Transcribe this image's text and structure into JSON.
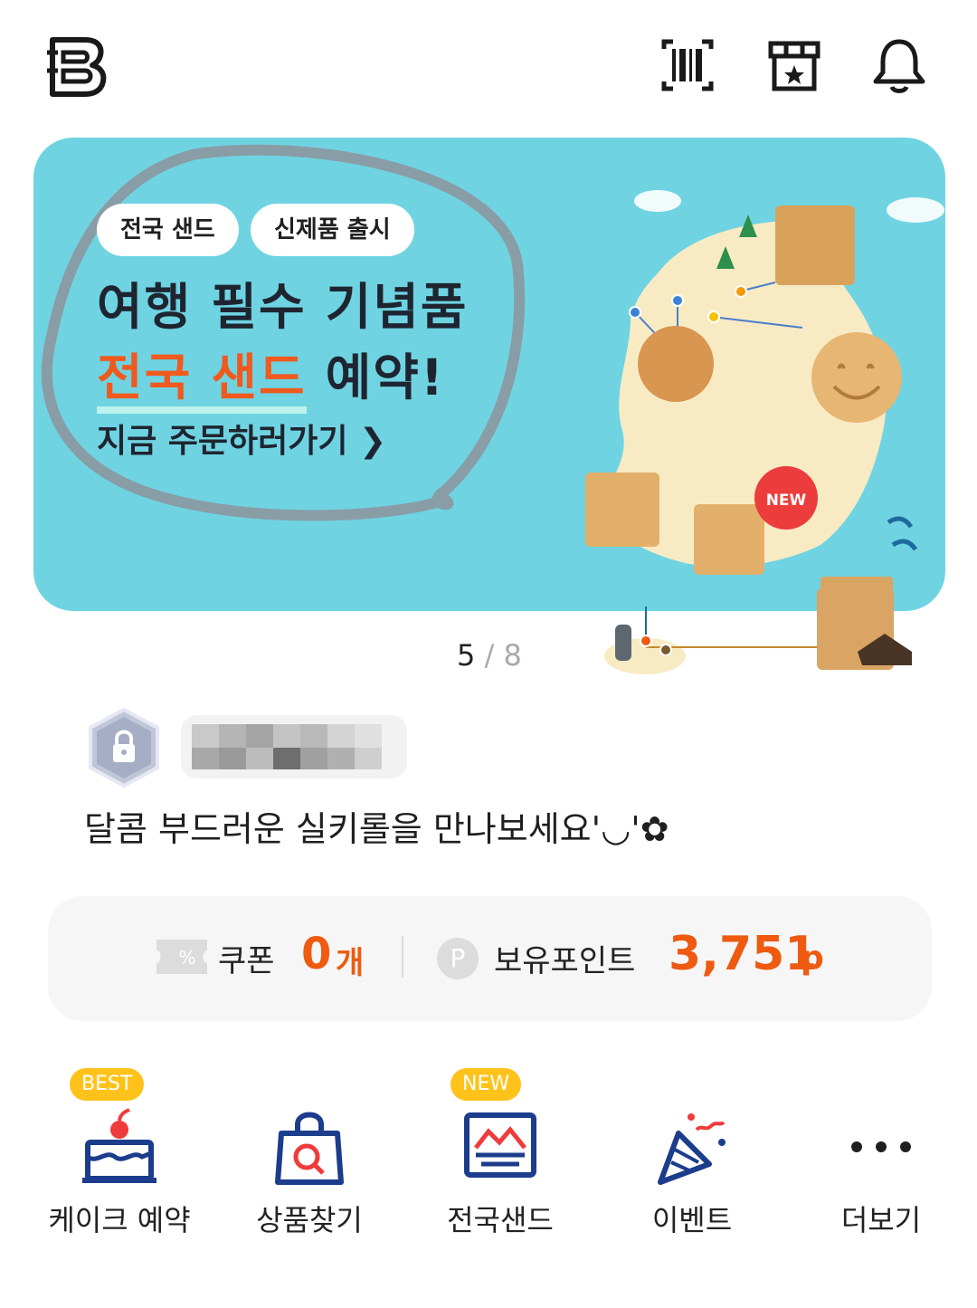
{
  "header": {
    "logo_icon": "b-logo-icon",
    "icons": [
      "barcode-icon",
      "store-icon",
      "bell-icon"
    ]
  },
  "banner": {
    "chips": [
      "전국 샌드",
      "신제품 출시"
    ],
    "title_line1": "여행 필수 기념품",
    "title_line2_highlight": "전국 샌드",
    "title_line2_rest": " 예약!",
    "cta": "지금 주문하러가기 ",
    "badge_new": "NEW",
    "pager": {
      "current": "5",
      "separator": "/",
      "total": "8"
    }
  },
  "profile": {
    "grade_icon": "lock-icon",
    "greeting": "달콤 부드러운 실키롤을 만나보세요'◡'✿"
  },
  "points_card": {
    "coupon_label": "쿠폰",
    "coupon_value": "0",
    "coupon_unit": "개",
    "points_label": "보유포인트",
    "points_value": "3,751",
    "points_unit": "p",
    "points_icon_letter": "P",
    "accent_color": "#ee5a10"
  },
  "quick_menu": [
    {
      "label": "케이크 예약",
      "badge": "BEST",
      "icon": "cake-icon"
    },
    {
      "label": "상품찾기",
      "badge": "",
      "icon": "shopping-bag-search-icon"
    },
    {
      "label": "전국샌드",
      "badge": "NEW",
      "icon": "sand-box-icon"
    },
    {
      "label": "이벤트",
      "badge": "",
      "icon": "party-popper-icon"
    },
    {
      "label": "더보기",
      "badge": "",
      "icon": "more-dots-icon"
    }
  ]
}
